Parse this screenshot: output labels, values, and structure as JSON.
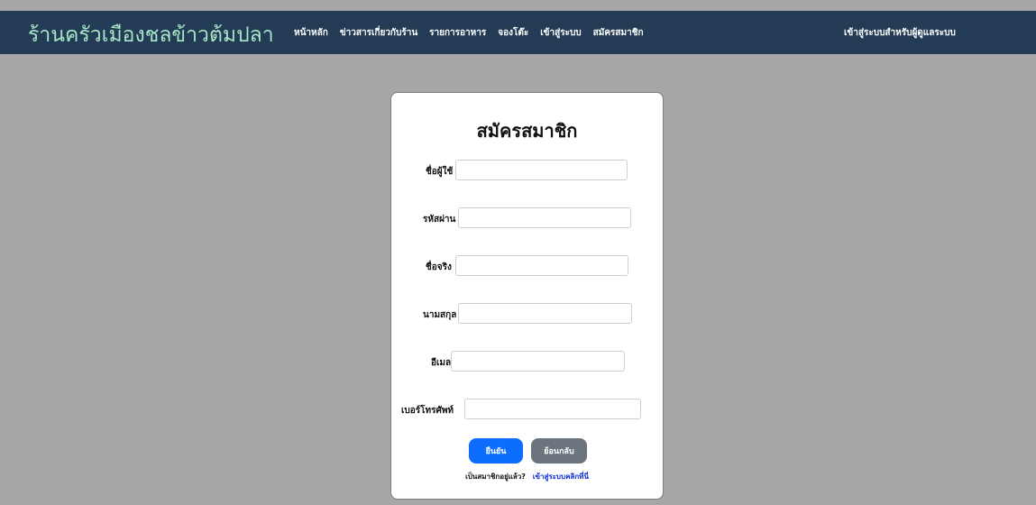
{
  "navbar": {
    "brand": "ร้านครัวเมืองชลข้าวต้มปลา",
    "links": [
      "หน้าหลัก",
      "ข่าวสารเกี่ยวกับร้าน",
      "รายการอาหาร",
      "จองโต๊ะ",
      "เข้าสู่ระบบ",
      "สมัครสมาชิก"
    ],
    "admin_link": "เข้าสู่ระบบสำหรับผู้ดูแลระบบ"
  },
  "form": {
    "title": "สมัครสมาชิก",
    "fields": [
      {
        "label": "ชื่อผู้ใช้",
        "value": ""
      },
      {
        "label": "รหัสผ่าน",
        "value": ""
      },
      {
        "label": "ชื่อจริง",
        "value": ""
      },
      {
        "label": "นามสกุล",
        "value": ""
      },
      {
        "label": "อีเมล",
        "value": ""
      },
      {
        "label": "เบอร์โทรศัพท์",
        "value": ""
      }
    ],
    "submit_label": "ยืนยัน",
    "back_label": "ย้อนกลับ",
    "login_prompt": "เป็นสมาชิกอยู่แล้ว?",
    "login_link": "เข้าสู่ระบบคลิกที่นี่"
  },
  "colors": {
    "navbar_bg": "#243b55",
    "brand_text": "#a8e6c8",
    "page_bg": "#a6a6a6",
    "primary_button": "#0d6efd",
    "secondary_button": "#6c757d",
    "link": "#0b2bd8"
  }
}
